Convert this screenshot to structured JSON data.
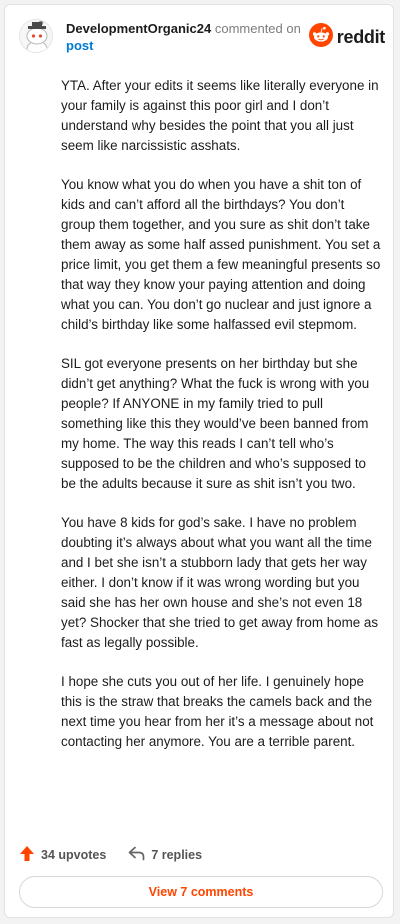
{
  "comment": {
    "author": "DevelopmentOrganic24",
    "meta": "commented on",
    "post_link": "post",
    "brand": "reddit",
    "paragraphs": [
      "YTA. After your edits it seems like literally everyone in your family is against this poor girl and I don’t understand why besides the point that you all just seem like narcissistic asshats.",
      "You know what you do when you have a shit ton of kids and can’t afford all the birthdays? You don’t group them together, and you sure as shit don’t take them away as some half assed punishment. You set a price limit, you get them a few meaningful presents so that way they know your paying attention and doing what you can. You don’t go nuclear and just ignore a child’s birthday like some halfassed evil stepmom.",
      "SIL got everyone presents on her birthday but she didn’t get anything? What the fuck is wrong with you people? If ANYONE in my family tried to pull something like this they would’ve been banned from my home. The way this reads I can’t tell who’s supposed to be the children and who’s supposed to be the adults because it sure as shit isn’t you two.",
      "You have 8 kids for god’s sake. I have no problem doubting it’s always about what you want all the time and I bet she isn’t a stubborn lady that gets her way either. I don’t know if it was wrong wording but you said she has her own house and she’s not even 18 yet? Shocker that she tried to get away from home as fast as legally possible.",
      "I hope she cuts you out of her life. I genuinely hope this is the straw that breaks the camels back and the next time you hear from her it’s a message about not contacting her anymore. You are a terrible parent."
    ],
    "upvotes_label": "34 upvotes",
    "replies_label": "7 replies",
    "view_comments_label": "View 7 comments"
  },
  "icons": {
    "avatar": "snoo-avatar-icon",
    "brand_logo": "reddit-logo-icon",
    "upvote": "upvote-arrow-icon",
    "reply": "reply-arrow-icon"
  },
  "colors": {
    "accent": "#ff4500",
    "link": "#0079d3",
    "text": "#1c1c1c",
    "muted": "#7c7c7c"
  }
}
